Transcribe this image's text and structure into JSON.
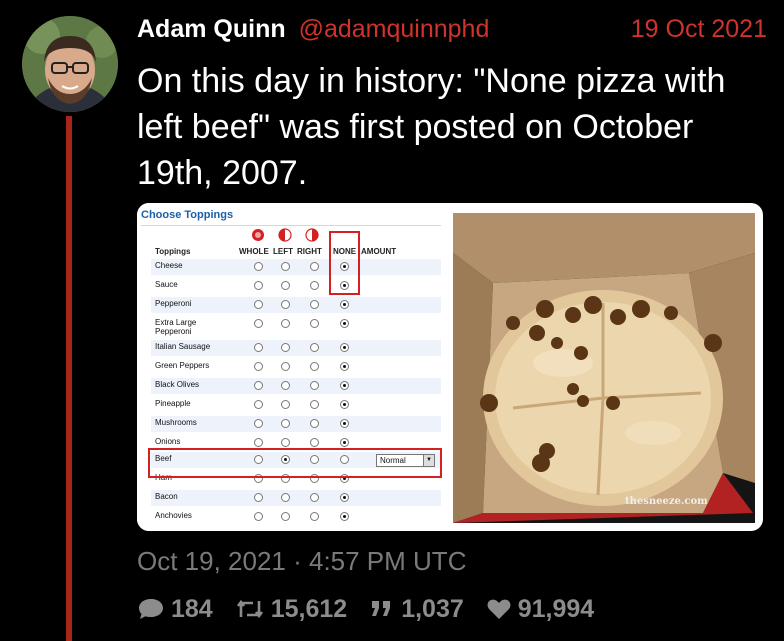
{
  "tweet": {
    "author_name": "Adam Quinn",
    "author_handle": "@adamquinnphd",
    "date": "19 Oct 2021",
    "text": "On this day in history: \"None pizza with left beef\" was first posted on October 19th, 2007.",
    "timestamp": "Oct 19, 2021 · 4:57 PM UTC",
    "stats": {
      "replies": "184",
      "retweets": "15,612",
      "quotes": "1,037",
      "likes": "91,994"
    },
    "colors": {
      "accent": "#d0332c",
      "thread_line": "#a8251c",
      "background": "#000000",
      "meta_text": "#7a7a7a"
    }
  },
  "order_form": {
    "title": "Choose Toppings",
    "columns": {
      "toppings": "Toppings",
      "whole": "WHOLE",
      "left": "LEFT",
      "right": "RIGHT",
      "none": "NONE",
      "amount": "AMOUNT"
    },
    "rows": [
      {
        "label": "Cheese",
        "selected": "none"
      },
      {
        "label": "Sauce",
        "selected": "none"
      },
      {
        "label": "Pepperoni",
        "selected": "none"
      },
      {
        "label": "Extra Large Pepperoni",
        "selected": "none"
      },
      {
        "label": "Italian Sausage",
        "selected": "none"
      },
      {
        "label": "Green Peppers",
        "selected": "none"
      },
      {
        "label": "Black Olives",
        "selected": "none"
      },
      {
        "label": "Pineapple",
        "selected": "none"
      },
      {
        "label": "Mushrooms",
        "selected": "none"
      },
      {
        "label": "Onions",
        "selected": "none"
      },
      {
        "label": "Beef",
        "selected": "left"
      },
      {
        "label": "Ham",
        "selected": "none"
      },
      {
        "label": "Bacon",
        "selected": "none"
      },
      {
        "label": "Anchovies",
        "selected": "none"
      }
    ],
    "beef_amount": "Normal"
  },
  "photo": {
    "watermark": "thesneeze.com"
  }
}
